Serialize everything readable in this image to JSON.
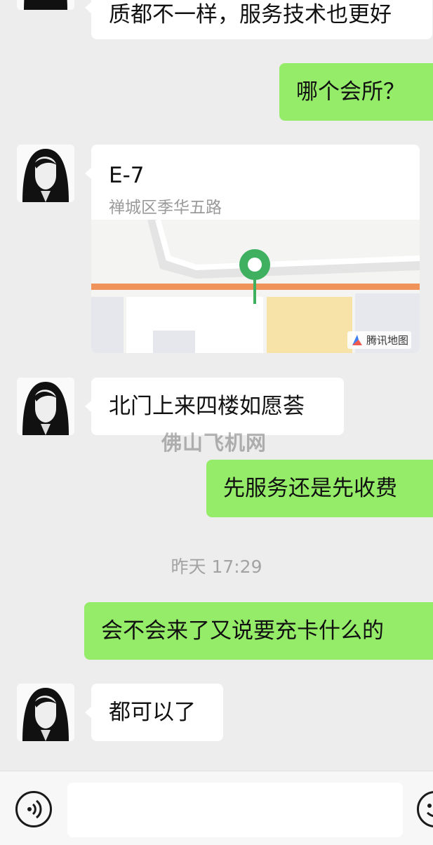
{
  "messages": {
    "m0": "质都不一样，服务技术也更好",
    "m1": "哪个会所？",
    "m2": "北门上来四楼如愿荟",
    "m3": "先服务还是先收费",
    "m4": "会不会来了又说要充卡什么的",
    "m5": "都可以了"
  },
  "location": {
    "name": "E-7",
    "address": "禅城区季华五路",
    "map_provider": "腾讯地图"
  },
  "timestamp": "昨天 17:29",
  "watermark": "佛山飞机网",
  "input": {
    "value": ""
  },
  "icons": {
    "voice": "voice-icon",
    "emoji": "emoji-icon",
    "pin": "location-pin-icon"
  },
  "colors": {
    "background": "#ededed",
    "incoming_bubble": "#ffffff",
    "outgoing_bubble": "#95ec69",
    "pin": "#3fb060",
    "road": "#f0935a"
  }
}
